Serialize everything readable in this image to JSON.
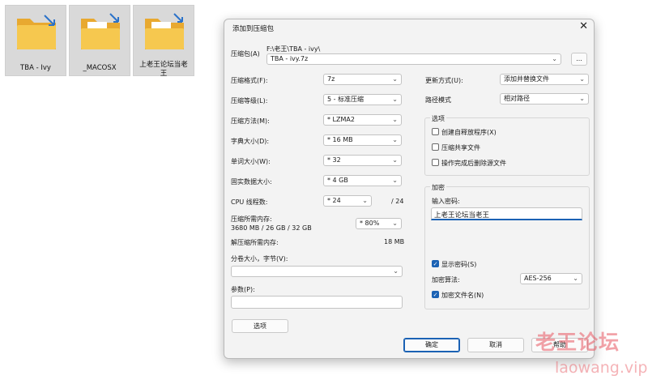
{
  "desktop": {
    "files": [
      {
        "label": "TBA - Ivy",
        "icon": "folder-shortcut-icon"
      },
      {
        "label": "_MACOSX",
        "icon": "folder-shortcut-icon"
      },
      {
        "label": "上老王论坛当老王",
        "icon": "folder-shortcut-icon"
      }
    ]
  },
  "dialog": {
    "title": "添加到压缩包",
    "archive_label": "压缩包(A)",
    "archive_path": "F:\\老王\\TBA - ivy\\",
    "archive_name": "TBA - ivy.7z",
    "browse_label": "...",
    "left": {
      "format_label": "压缩格式(F):",
      "format_value": "7z",
      "level_label": "压缩等级(L):",
      "level_value": "5 - 标准压缩",
      "method_label": "压缩方法(M):",
      "method_value": "* LZMA2",
      "dict_label": "字典大小(D):",
      "dict_value": "* 16 MB",
      "word_label": "单词大小(W):",
      "word_value": "* 32",
      "solid_label": "固实数据大小:",
      "solid_value": "* 4 GB",
      "threads_label": "CPU 线程数:",
      "threads_value": "* 24",
      "threads_max": "/ 24",
      "mem_label": "压缩所需内存:",
      "mem_value": "3680 MB / 26 GB / 32 GB",
      "mem_percent": "* 80%",
      "decomp_label": "解压缩所需内存:",
      "decomp_value": "18 MB",
      "volume_label": "分卷大小，字节(V):",
      "params_label": "参数(P):",
      "options_button": "选项"
    },
    "right": {
      "update_label": "更新方式(U):",
      "update_value": "添加并替换文件",
      "path_label": "路径模式",
      "path_value": "相对路径",
      "options_title": "选项",
      "opt_sfx": "创建自释放程序(X)",
      "opt_shared": "压缩共享文件",
      "opt_delete": "操作完成后删除源文件",
      "enc_title": "加密",
      "pwd_label": "输入密码:",
      "pwd_value": "上老王论坛当老王",
      "show_pwd": "显示密码(S)",
      "enc_method_label": "加密算法:",
      "enc_method_value": "AES-256",
      "enc_names": "加密文件名(N)"
    },
    "buttons": {
      "ok": "确定",
      "cancel": "取消",
      "help": "帮助"
    }
  },
  "watermark": {
    "line1": "老王论坛",
    "line2": "laowang.vip"
  },
  "colors": {
    "accent": "#1b62b4",
    "folder": "#f2c14e",
    "watermark": "#e85660"
  }
}
